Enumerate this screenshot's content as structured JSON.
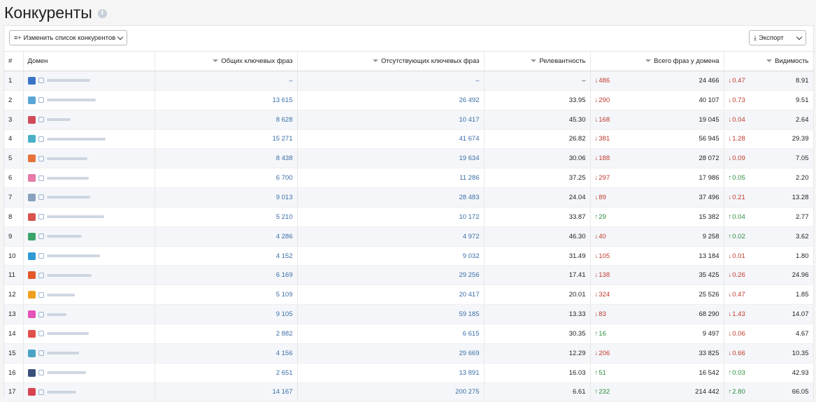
{
  "page": {
    "title": "Конкуренты",
    "info_icon": "info-icon"
  },
  "toolbar": {
    "change_list_label": "Изменить список конкурентов",
    "change_list_icon": "list-add-icon",
    "export_label": "Экспорт",
    "export_icon": "download-icon"
  },
  "columns": {
    "index": "#",
    "domain": "Домен",
    "total_keywords": "Общих ключевых фраз",
    "missing_keywords": "Отсутствующих ключевых фраз",
    "relevance": "Релевантность",
    "domain_phrases": "Всего фраз у домена",
    "visibility": "Видимость"
  },
  "colors": {
    "down": "#c0392b",
    "up": "#2e8b3e",
    "link": "#3b6ea8"
  },
  "rows": [
    {
      "idx": "1",
      "favicon": "#3b73c7",
      "total": "–",
      "missing": "–",
      "relevance": "–",
      "phr_dir": "down",
      "phr_delta": "486",
      "phrases": "24 466",
      "vis_dir": "down",
      "vis_delta": "0.47",
      "visibility": "8.91"
    },
    {
      "idx": "2",
      "favicon": "#5aa6d6",
      "total": "13 615",
      "missing": "26 492",
      "relevance": "33.95",
      "phr_dir": "down",
      "phr_delta": "290",
      "phrases": "40 107",
      "vis_dir": "down",
      "vis_delta": "0.73",
      "visibility": "9.51"
    },
    {
      "idx": "3",
      "favicon": "#d04a5a",
      "total": "8 628",
      "missing": "10 417",
      "relevance": "45.30",
      "phr_dir": "down",
      "phr_delta": "168",
      "phrases": "19 045",
      "vis_dir": "down",
      "vis_delta": "0.04",
      "visibility": "2.64"
    },
    {
      "idx": "4",
      "favicon": "#48b0c8",
      "total": "15 271",
      "missing": "41 674",
      "relevance": "26.82",
      "phr_dir": "down",
      "phr_delta": "381",
      "phrases": "56 945",
      "vis_dir": "down",
      "vis_delta": "1.28",
      "visibility": "29.39"
    },
    {
      "idx": "5",
      "favicon": "#e8733a",
      "total": "8 438",
      "missing": "19 634",
      "relevance": "30.06",
      "phr_dir": "down",
      "phr_delta": "188",
      "phrases": "28 072",
      "vis_dir": "down",
      "vis_delta": "0.09",
      "visibility": "7.05"
    },
    {
      "idx": "6",
      "favicon": "#e67aa9",
      "total": "6 700",
      "missing": "11 286",
      "relevance": "37.25",
      "phr_dir": "down",
      "phr_delta": "297",
      "phrases": "17 986",
      "vis_dir": "up",
      "vis_delta": "0.05",
      "visibility": "2.20"
    },
    {
      "idx": "7",
      "favicon": "#8aa2bd",
      "total": "9 013",
      "missing": "28 483",
      "relevance": "24.04",
      "phr_dir": "down",
      "phr_delta": "89",
      "phrases": "37 496",
      "vis_dir": "down",
      "vis_delta": "0.21",
      "visibility": "13.28"
    },
    {
      "idx": "8",
      "favicon": "#d9534f",
      "total": "5 210",
      "missing": "10 172",
      "relevance": "33.87",
      "phr_dir": "up",
      "phr_delta": "29",
      "phrases": "15 382",
      "vis_dir": "up",
      "vis_delta": "0.04",
      "visibility": "2.77"
    },
    {
      "idx": "9",
      "favicon": "#3aa36a",
      "total": "4 286",
      "missing": "4 972",
      "relevance": "46.30",
      "phr_dir": "down",
      "phr_delta": "40",
      "phrases": "9 258",
      "vis_dir": "up",
      "vis_delta": "0.02",
      "visibility": "3.62"
    },
    {
      "idx": "10",
      "favicon": "#2f9bd4",
      "total": "4 152",
      "missing": "9 032",
      "relevance": "31.49",
      "phr_dir": "down",
      "phr_delta": "105",
      "phrases": "13 184",
      "vis_dir": "down",
      "vis_delta": "0.01",
      "visibility": "1.80"
    },
    {
      "idx": "11",
      "favicon": "#e3572b",
      "total": "6 169",
      "missing": "29 256",
      "relevance": "17.41",
      "phr_dir": "down",
      "phr_delta": "138",
      "phrases": "35 425",
      "vis_dir": "down",
      "vis_delta": "0.26",
      "visibility": "24.96"
    },
    {
      "idx": "12",
      "favicon": "#f0a020",
      "total": "5 109",
      "missing": "20 417",
      "relevance": "20.01",
      "phr_dir": "down",
      "phr_delta": "324",
      "phrases": "25 526",
      "vis_dir": "down",
      "vis_delta": "0.47",
      "visibility": "1.85"
    },
    {
      "idx": "13",
      "favicon": "#e552b8",
      "total": "9 105",
      "missing": "59 185",
      "relevance": "13.33",
      "phr_dir": "down",
      "phr_delta": "83",
      "phrases": "68 290",
      "vis_dir": "down",
      "vis_delta": "1.43",
      "visibility": "14.07"
    },
    {
      "idx": "14",
      "favicon": "#e0504a",
      "total": "2 882",
      "missing": "6 615",
      "relevance": "30.35",
      "phr_dir": "up",
      "phr_delta": "16",
      "phrases": "9 497",
      "vis_dir": "down",
      "vis_delta": "0.06",
      "visibility": "4.67"
    },
    {
      "idx": "15",
      "favicon": "#4aa3c4",
      "total": "4 156",
      "missing": "29 669",
      "relevance": "12.29",
      "phr_dir": "down",
      "phr_delta": "206",
      "phrases": "33 825",
      "vis_dir": "down",
      "vis_delta": "0.66",
      "visibility": "10.35"
    },
    {
      "idx": "16",
      "favicon": "#3a4f7a",
      "total": "2 651",
      "missing": "13 891",
      "relevance": "16.03",
      "phr_dir": "up",
      "phr_delta": "51",
      "phrases": "16 542",
      "vis_dir": "up",
      "vis_delta": "0.03",
      "visibility": "42.93"
    },
    {
      "idx": "17",
      "favicon": "#d9434f",
      "total": "14 167",
      "missing": "200 275",
      "relevance": "6.61",
      "phr_dir": "up",
      "phr_delta": "232",
      "phrases": "214 442",
      "vis_dir": "up",
      "vis_delta": "2.80",
      "visibility": "66.05"
    }
  ]
}
